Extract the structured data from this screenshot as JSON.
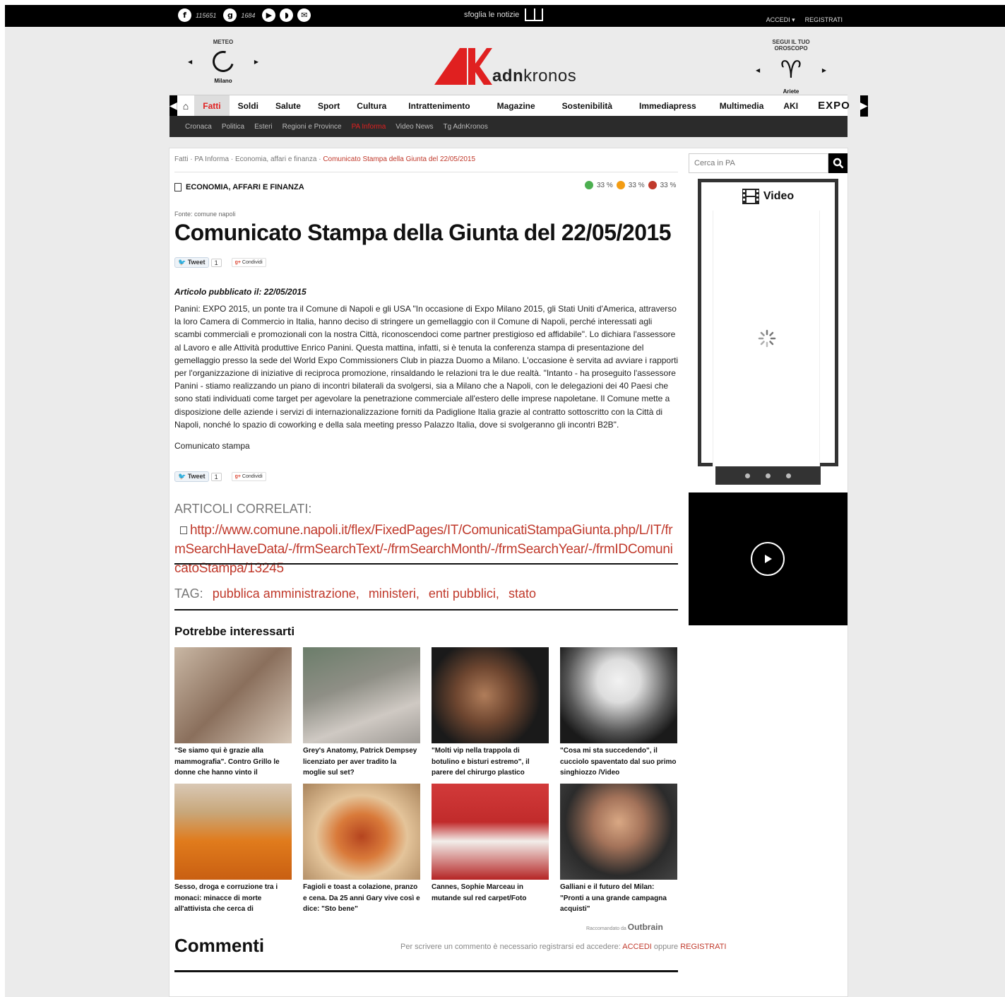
{
  "topbar": {
    "facebook_count": "115651",
    "gplus_count": "1684",
    "sfoglia": "sfoglia le notizie",
    "accedi": "ACCEDI",
    "registrati": "REGISTRATI"
  },
  "meteo": {
    "label": "METEO",
    "city": "Milano"
  },
  "logo": {
    "bold": "adn",
    "rest": "kronos"
  },
  "oroscopo": {
    "label": "SEGUI IL TUO OROSCOPO",
    "sign": "Ariete",
    "symbol": "♈"
  },
  "nav": {
    "items": [
      "Fatti",
      "Soldi",
      "Salute",
      "Sport",
      "Cultura",
      "Intrattenimento",
      "Magazine",
      "Sostenibilità",
      "Immediapress",
      "Multimedia",
      "AKI"
    ],
    "expo": "EXPO",
    "subitems": [
      "Cronaca",
      "Politica",
      "Esteri",
      "Regioni e Province",
      "PA Informa",
      "Video News",
      "Tg AdnKronos"
    ]
  },
  "breadcrumb": {
    "items": [
      "Fatti",
      "PA Informa",
      "Economia, affari e finanza"
    ],
    "current": "Comunicato Stampa della Giunta del 22/05/2015"
  },
  "article": {
    "section": "ECONOMIA, AFFARI E FINANZA",
    "votes": [
      "33 %",
      "33 %",
      "33 %"
    ],
    "fonte": "Fonte: comune napoli",
    "title": "Comunicato Stampa della Giunta del 22/05/2015",
    "tweet_label": "Tweet",
    "tweet_count": "1",
    "gplus_label": "Condividi",
    "published": "Articolo pubblicato il: 22/05/2015",
    "body": "Panini: EXPO 2015, un ponte tra il Comune di Napoli e gli USA \"In occasione di Expo Milano 2015, gli Stati Uniti d'America, attraverso la loro Camera di Commercio in Italia, hanno deciso di stringere un gemellaggio con il Comune di Napoli, perché interessati agli scambi commerciali e promozionali con la nostra Città, riconoscendoci come partner prestigioso ed affidabile\". Lo dichiara l'assessore al Lavoro e alle Attività produttive Enrico Panini. Questa mattina, infatti, si è tenuta la conferenza stampa di presentazione del gemellaggio presso la sede del World Expo Commissioners Club in piazza Duomo a Milano. L'occasione è servita ad avviare i rapporti per l'organizzazione di iniziative di reciproca promozione, rinsaldando le relazioni tra le due realtà. \"Intanto - ha proseguito l'assessore Panini - stiamo realizzando un piano di incontri bilaterali da svolgersi, sia a Milano che a Napoli, con le delegazioni dei 40 Paesi che sono stati individuati come target per agevolare la penetrazione commerciale all'estero delle imprese napoletane. Il Comune mette a disposizione delle aziende i servizi di internazionalizzazione forniti da Padiglione Italia grazie al contratto sottoscritto con la Città di Napoli, nonché lo spazio di coworking e della sala meeting presso Palazzo Italia, dove si svolgeranno gli incontri B2B\".",
    "comunicato": "Comunicato stampa"
  },
  "correlati": {
    "heading": "ARTICOLI CORRELATI:",
    "link": "http://www.comune.napoli.it/flex/FixedPages/IT/ComunicatiStampaGiunta.php/L/IT/frmSearchHaveData/-/frmSearchText/-/frmSearchMonth/-/frmSearchYear/-/frmIDComunicatoStampa/13245"
  },
  "tags": {
    "label": "TAG:",
    "items": [
      "pubblica amministrazione,",
      "ministeri,",
      "enti pubblici,",
      "stato"
    ]
  },
  "potrebbe": {
    "heading": "Potrebbe interessarti",
    "cards": [
      "\"Se siamo qui è grazie alla mammografia\". Contro Grillo le donne che hanno vinto il",
      "Grey's Anatomy, Patrick Dempsey licenziato per aver tradito la moglie sul set?",
      "\"Molti vip nella trappola di botulino e bisturi estremo\", il parere del chirurgo plastico",
      "\"Cosa mi sta succedendo\", il cucciolo spaventato dal suo primo singhiozzo /Video",
      "Sesso, droga e corruzione tra i monaci: minacce di morte all'attivista che cerca di",
      "Fagioli e toast a colazione, pranzo e cena. Da 25 anni Gary vive così e dice: \"Sto bene\"",
      "Cannes, Sophie Marceau in mutande sul red carpet/Foto",
      "Galliani e il futuro del Milan: \"Pronti a una grande campagna acquisti\""
    ],
    "outbrain_pre": "Raccomandato da",
    "outbrain": "Outbrain"
  },
  "commenti": {
    "heading": "Commenti",
    "note": "Per scrivere un commento è necessario registrarsi ed accedere:",
    "accedi": "ACCEDI",
    "oppure": "oppure",
    "registrati": "REGISTRATI"
  },
  "sidebar": {
    "search_placeholder": "Cerca in PA",
    "video_label": "Video"
  },
  "colors": {
    "accent": "#e02020",
    "link": "#c0392b",
    "bar": "#000000",
    "subnav": "#2b2b2b"
  }
}
